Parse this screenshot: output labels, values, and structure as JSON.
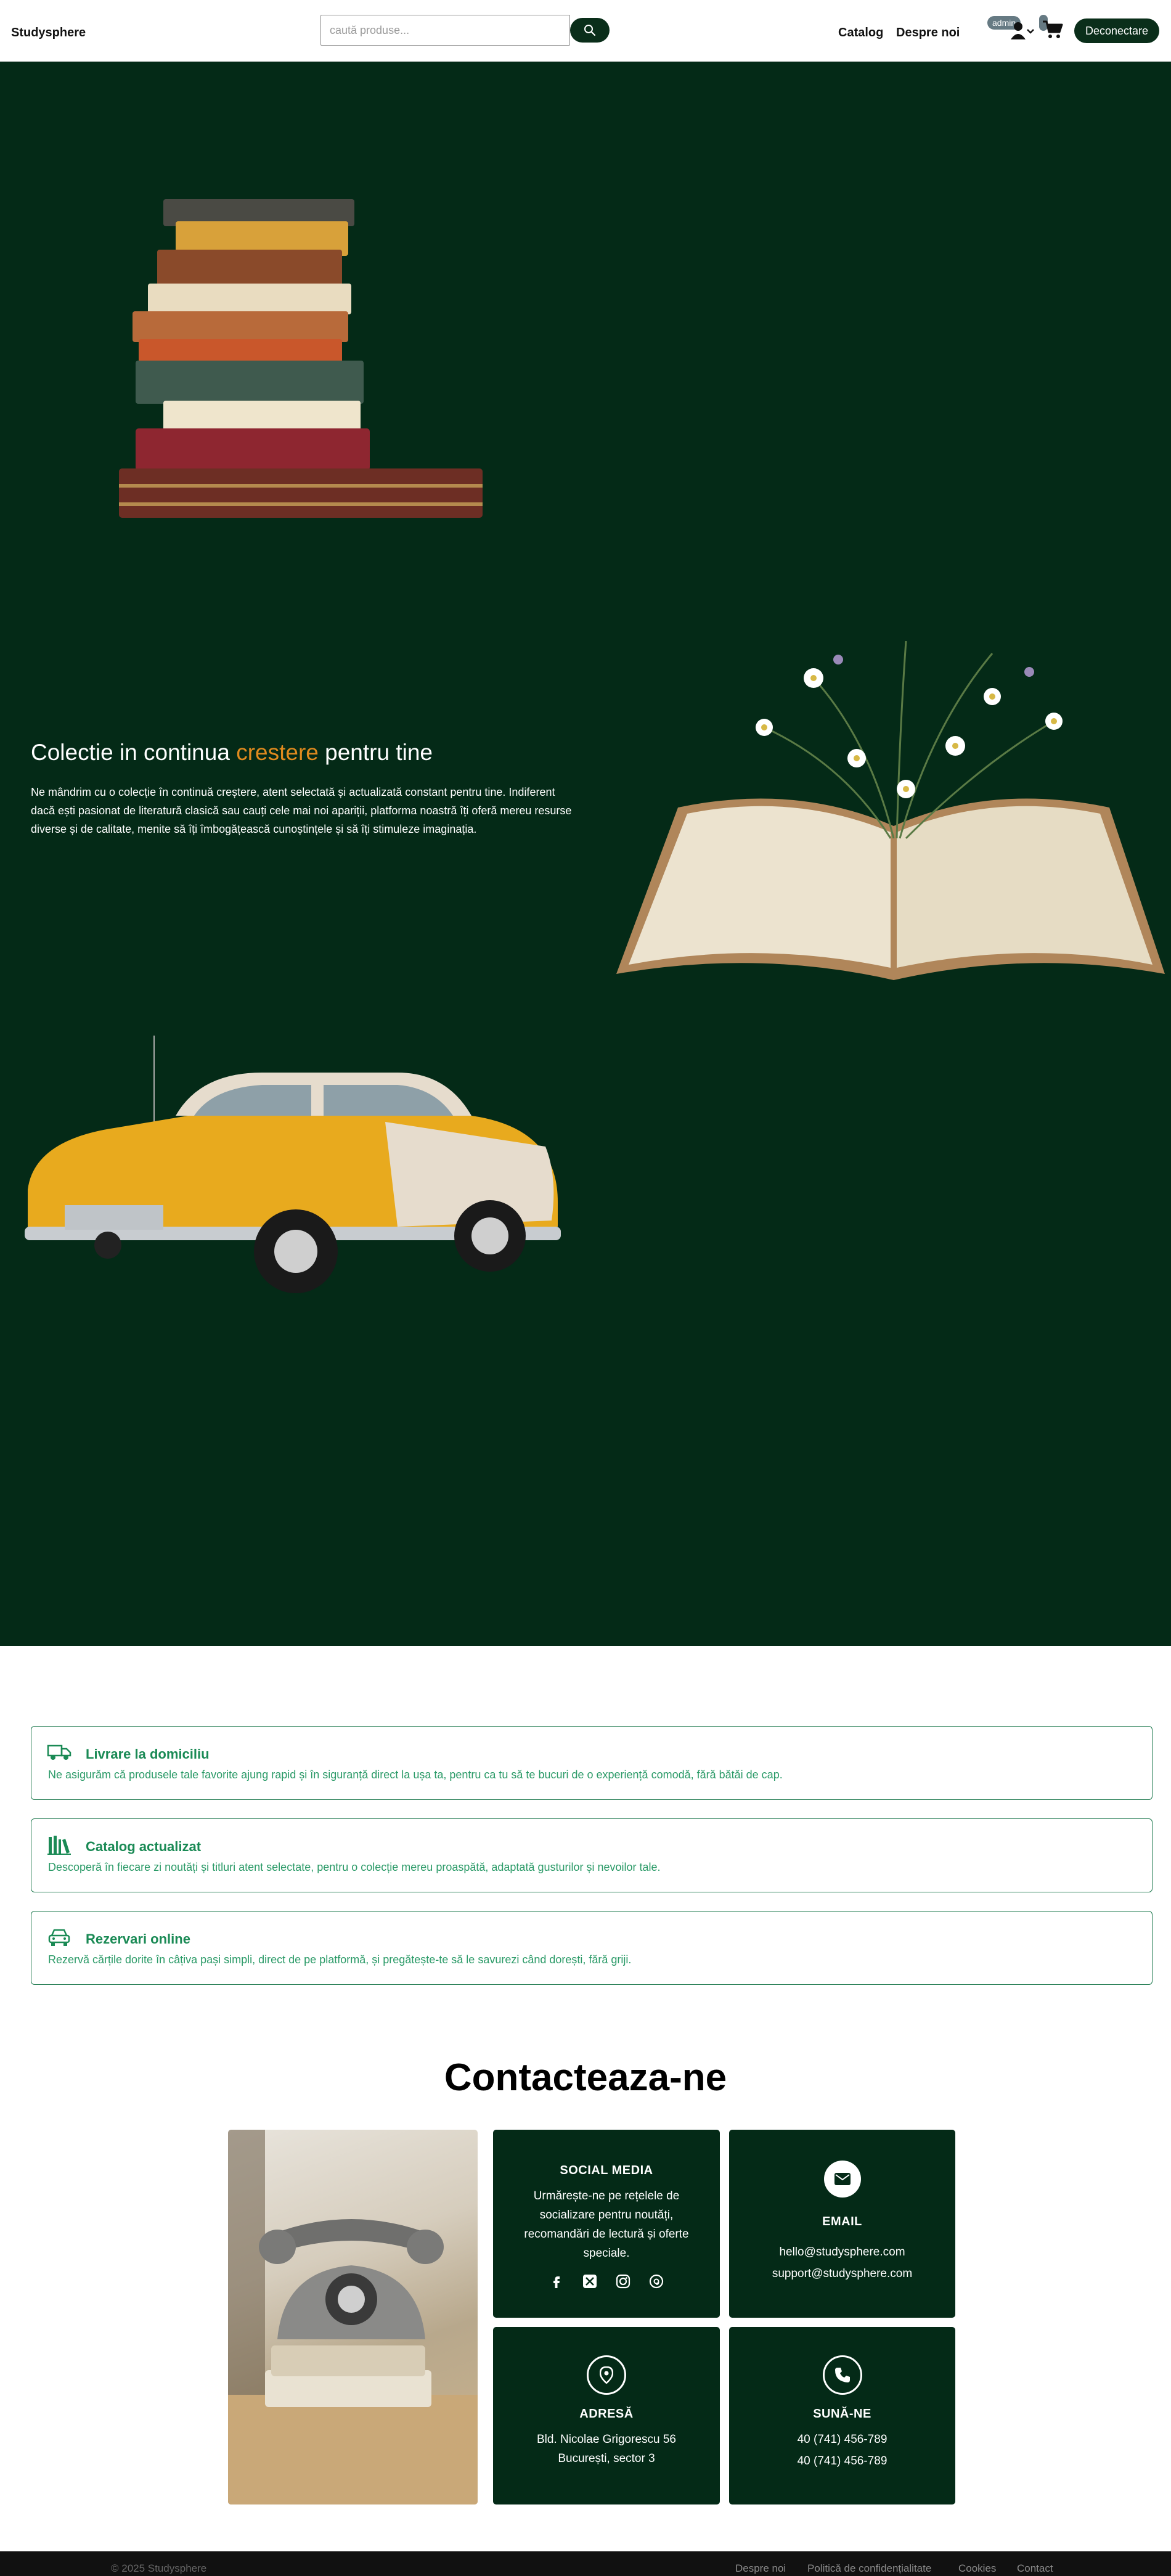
{
  "navbar": {
    "brand": "Studysphere",
    "search_placeholder": "caută produse...",
    "links": [
      "Catalog",
      "Despre noi"
    ],
    "user_badge": "admin",
    "logout_label": "Deconectare"
  },
  "hero": {
    "title_pre": "Colectie in continua ",
    "title_accent": "crestere",
    "title_post": " pentru tine",
    "text": "Ne mândrim cu o colecție în continuă creștere, atent selectată și actualizată constant pentru tine. Indiferent dacă ești pasionat de literatură clasică sau cauți cele mai noi apariții, platforma noastră îți oferă mereu resurse diverse și de calitate, menite să îți îmbogățească cunoștințele și să îți stimuleze imaginația."
  },
  "features": [
    {
      "icon": "truck-icon",
      "title": "Livrare la domiciliu",
      "text": "Ne asigurăm că produsele tale favorite ajung rapid și în siguranță direct la ușa ta, pentru ca tu să te bucuri de o experiență comodă, fără bătăi de cap."
    },
    {
      "icon": "books-icon",
      "title": "Catalog actualizat",
      "text": "Descoperă în fiecare zi noutăți și titluri atent selectate, pentru o colecție mereu proaspătă, adaptată gusturilor și nevoilor tale."
    },
    {
      "icon": "car-icon",
      "title": "Rezervari online",
      "text": "Rezervă cărțile dorite în câțiva pași simpli, direct de pe platformă, și pregătește-te să le savurezi când dorești, fără griji."
    }
  ],
  "contact": {
    "title": "Contacteaza-ne",
    "social": {
      "heading": "SOCIAL MEDIA",
      "text": "Urmărește-ne pe rețelele de socializare pentru noutăți, recomandări de lectură și oferte speciale."
    },
    "email": {
      "heading": "EMAIL",
      "lines": [
        "hello@studysphere.com",
        "support@studysphere.com"
      ]
    },
    "address": {
      "heading": "ADRESĂ",
      "lines": [
        "Bld. Nicolae Grigorescu 56",
        "București, sector 3"
      ]
    },
    "phone": {
      "heading": "SUNĂ-NE",
      "lines": [
        "40 (741) 456-789",
        "40 (741) 456-789"
      ]
    }
  },
  "footer": {
    "copyright": "© 2025 Studysphere",
    "links": [
      "Despre noi",
      "Politică de confidențialitate",
      "Cookies",
      "Contact"
    ]
  },
  "colors": {
    "brand_dark": "#042a17",
    "accent": "#e08a1e",
    "feature_green": "#1a8a55"
  }
}
